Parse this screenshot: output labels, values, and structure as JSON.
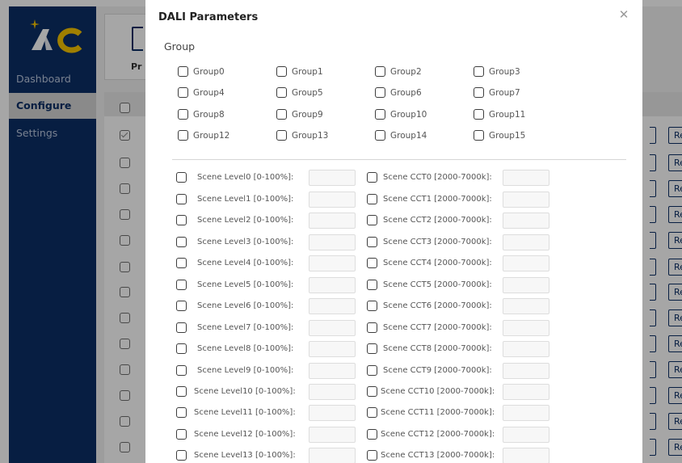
{
  "sidebar": {
    "items": [
      {
        "label": "Dashboard",
        "active": false
      },
      {
        "label": "Configure",
        "active": true
      },
      {
        "label": "Settings",
        "active": false
      }
    ]
  },
  "main": {
    "card_label": "Pr",
    "row_button_label": "Re"
  },
  "modal": {
    "title": "DALI Parameters",
    "close_glyph": "✕",
    "group_section_label": "Group",
    "groups": [
      "Group0",
      "Group1",
      "Group2",
      "Group3",
      "Group4",
      "Group5",
      "Group6",
      "Group7",
      "Group8",
      "Group9",
      "Group10",
      "Group11",
      "Group12",
      "Group13",
      "Group14",
      "Group15"
    ],
    "scene_levels": [
      "Scene Level0 [0-100%]:",
      "Scene Level1 [0-100%]:",
      "Scene Level2 [0-100%]:",
      "Scene Level3 [0-100%]:",
      "Scene Level4 [0-100%]:",
      "Scene Level5 [0-100%]:",
      "Scene Level6 [0-100%]:",
      "Scene Level7 [0-100%]:",
      "Scene Level8 [0-100%]:",
      "Scene Level9 [0-100%]:",
      "Scene Level10 [0-100%]:",
      "Scene Level11 [0-100%]:",
      "Scene Level12 [0-100%]:",
      "Scene Level13 [0-100%]:"
    ],
    "scene_ccts": [
      "Scene CCT0 [2000-7000k]:",
      "Scene CCT1 [2000-7000k]:",
      "Scene CCT2 [2000-7000k]:",
      "Scene CCT3 [2000-7000k]:",
      "Scene CCT4 [2000-7000k]:",
      "Scene CCT5 [2000-7000k]:",
      "Scene CCT6 [2000-7000k]:",
      "Scene CCT7 [2000-7000k]:",
      "Scene CCT8 [2000-7000k]:",
      "Scene CCT9 [2000-7000k]:",
      "Scene CCT10 [2000-7000k]:",
      "Scene CCT11 [2000-7000k]:",
      "Scene CCT12 [2000-7000k]:",
      "Scene CCT13 [2000-7000k]:"
    ]
  },
  "colors": {
    "sidebar_bg": "#0c2e66",
    "accent": "#0c2e66",
    "logo_yellow": "#f5c400",
    "logo_star": "#f5c400"
  }
}
